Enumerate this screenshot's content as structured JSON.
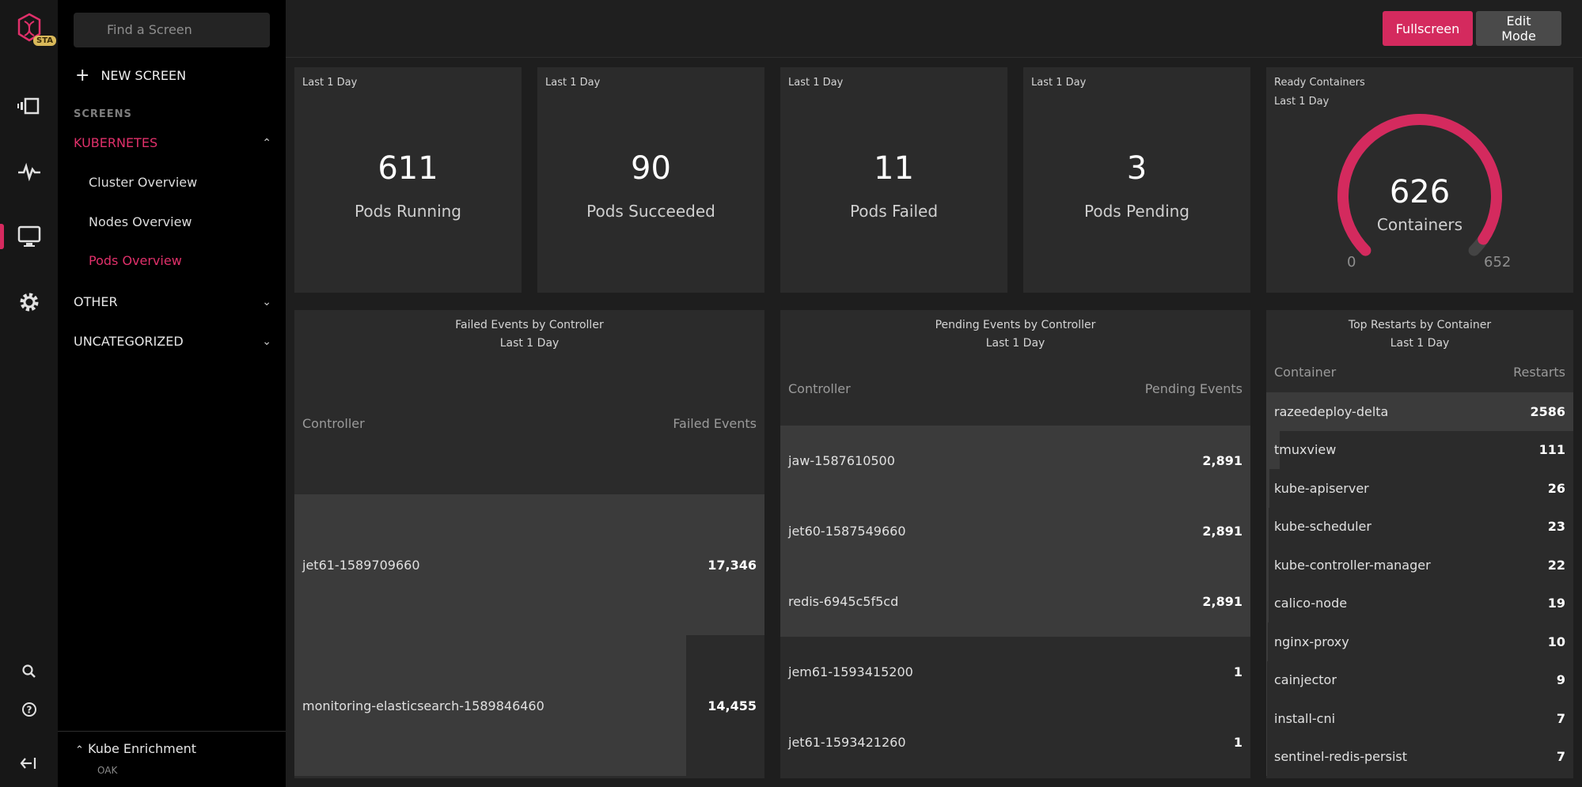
{
  "rail": {
    "badge": "STA"
  },
  "nav": {
    "search_placeholder": "Find a Screen",
    "new_screen": "NEW SCREEN",
    "section_label": "SCREENS",
    "groups": [
      {
        "label": "KUBERNETES",
        "items": [
          "Cluster Overview",
          "Nodes Overview",
          "Pods Overview"
        ]
      },
      {
        "label": "OTHER"
      },
      {
        "label": "UNCATEGORIZED"
      }
    ],
    "footer": {
      "title": "Kube Enrichment",
      "subtitle": "OAK"
    }
  },
  "toolbar": {
    "fullscreen": "Fullscreen",
    "edit_mode": "Edit Mode"
  },
  "stats": [
    {
      "range": "Last 1 Day",
      "value": "611",
      "label": "Pods Running"
    },
    {
      "range": "Last 1 Day",
      "value": "90",
      "label": "Pods Succeeded"
    },
    {
      "range": "Last 1 Day",
      "value": "11",
      "label": "Pods Failed"
    },
    {
      "range": "Last 1 Day",
      "value": "3",
      "label": "Pods Pending"
    }
  ],
  "gauge": {
    "title": "Ready Containers",
    "range": "Last 1 Day",
    "value": "626",
    "label": "Containers",
    "min": "0",
    "max": "652",
    "fraction": 0.96,
    "color": "#d42a5e"
  },
  "failed_events": {
    "title": "Failed Events by Controller",
    "range": "Last 1 Day",
    "col_controller": "Controller",
    "col_value": "Failed Events",
    "rows": [
      {
        "name": "jet61-1589709660",
        "value": "17,346",
        "fraction": 1.0
      },
      {
        "name": "monitoring-elasticsearch-1589846460",
        "value": "14,455",
        "fraction": 0.833
      }
    ]
  },
  "pending_events": {
    "title": "Pending Events by Controller",
    "range": "Last 1 Day",
    "col_controller": "Controller",
    "col_value": "Pending Events",
    "rows": [
      {
        "name": "jaw-1587610500",
        "value": "2,891",
        "fraction": 1.0
      },
      {
        "name": "jet60-1587549660",
        "value": "2,891",
        "fraction": 1.0
      },
      {
        "name": "redis-6945c5f5cd",
        "value": "2,891",
        "fraction": 1.0
      },
      {
        "name": "jem61-1593415200",
        "value": "1",
        "fraction": 0.0
      },
      {
        "name": "jet61-1593421260",
        "value": "1",
        "fraction": 0.0
      }
    ]
  },
  "restarts": {
    "title": "Top Restarts by Container",
    "range": "Last 1 Day",
    "col_container": "Container",
    "col_value": "Restarts",
    "rows": [
      {
        "name": "razeedeploy-delta",
        "value": "2586",
        "fraction": 1.0
      },
      {
        "name": "tmuxview",
        "value": "111",
        "fraction": 0.043
      },
      {
        "name": "kube-apiserver",
        "value": "26",
        "fraction": 0.01
      },
      {
        "name": "kube-scheduler",
        "value": "23",
        "fraction": 0.009
      },
      {
        "name": "kube-controller-manager",
        "value": "22",
        "fraction": 0.009
      },
      {
        "name": "calico-node",
        "value": "19",
        "fraction": 0.007
      },
      {
        "name": "nginx-proxy",
        "value": "10",
        "fraction": 0.004
      },
      {
        "name": "cainjector",
        "value": "9",
        "fraction": 0.003
      },
      {
        "name": "install-cni",
        "value": "7",
        "fraction": 0.003
      },
      {
        "name": "sentinel-redis-persist",
        "value": "7",
        "fraction": 0.003
      }
    ]
  }
}
